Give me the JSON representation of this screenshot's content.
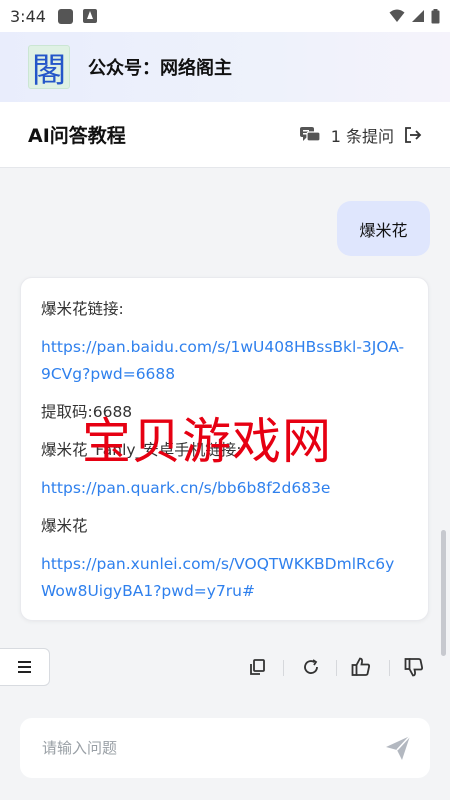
{
  "status_bar": {
    "time": "3:44"
  },
  "banner": {
    "logo_char": "閣",
    "title": "公众号：网络阁主"
  },
  "header": {
    "title": "AI问答教程",
    "count_text": "1 条提问"
  },
  "conversation": {
    "user_message": "爆米花",
    "answer": {
      "label_baidu": "爆米花链接:",
      "link_baidu": "https://pan.baidu.com/s/1wU408HBssBkl-3JOA-9CVg?pwd=6688",
      "extract_code": "提取码:6688",
      "label_quark": "爆米花_Fanly_安卓手机链接:",
      "link_quark": "https://pan.quark.cn/s/bb6b8f2d683e",
      "label_xunlei": "爆米花",
      "link_xunlei": "https://pan.xunlei.com/s/VOQTWKKBDmlRc6yWow8UigyBA1?pwd=y7ru#"
    }
  },
  "watermark": {
    "text": "宝贝游戏网"
  },
  "input": {
    "placeholder": "请输入问题",
    "value": ""
  },
  "icons": {
    "status": [
      "app-square-icon",
      "a-badge-icon",
      "wifi-icon",
      "signal-icon",
      "battery-icon"
    ],
    "actions": [
      "copy-icon",
      "refresh-icon",
      "thumbs-up-icon",
      "thumbs-down-icon"
    ],
    "input": [
      "send-icon"
    ],
    "header": [
      "chat-bubbles-icon",
      "exit-icon"
    ],
    "menu": [
      "menu-icon"
    ]
  },
  "colors": {
    "link": "#2f80ed",
    "user_bubble": "#dfe6fd",
    "watermark": "#e60012",
    "logo_text": "#2456c9"
  }
}
